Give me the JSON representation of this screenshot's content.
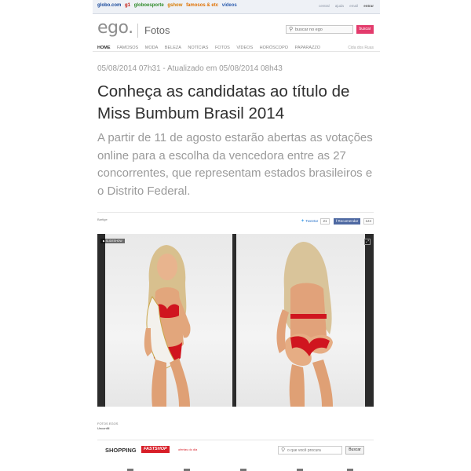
{
  "globobar": {
    "links": [
      "globo.com",
      "g1",
      "globoesporte",
      "gshow",
      "famosos & etc",
      "vídeos"
    ],
    "right": [
      "central",
      "ajuda",
      "email",
      "entrar"
    ]
  },
  "header": {
    "logo": "ego.",
    "section": "Fotos",
    "search_placeholder": "buscar no ego",
    "search_button": "buscar"
  },
  "nav": {
    "items": [
      "HOME",
      "FAMOSOS",
      "MODA",
      "BELEZA",
      "NOTÍCIAS",
      "FOTOS",
      "VÍDEOS",
      "HORÓSCOPO",
      "PAPARAZZO"
    ],
    "right": "Cida dos Ruas"
  },
  "article": {
    "dateline": "05/08/2014 07h31 - Atualizado em 05/08/2014 08h43",
    "headline": "Conheça as candidatas ao título de Miss Bumbum Brasil 2014",
    "lead": "A partir de 11 de agosto estarão abertas as votações online para a escolha da vencedora entre as 27 concorrentes, que representam estados brasileiros e o Distrito Federal.",
    "credit_top": "Bartige",
    "tweet_label": "Tweetar",
    "tweet_count": "21",
    "fb_label": "Recomendar",
    "fb_count": "124",
    "slideshow_label": "SLIDESHOW",
    "photo_credit_label": "FOTOS EGOS",
    "photo_credit_name": "Unconfill"
  },
  "shopping": {
    "label": "SHOPPING",
    "brand": "FASTSHOP",
    "tag": "ofertas do dia",
    "search_placeholder": "o que você procura",
    "search_button": "Buscar"
  },
  "colors": {
    "accent": "#e33b6c",
    "bikini": "#d0151f",
    "sash": "#f3f1ec"
  }
}
